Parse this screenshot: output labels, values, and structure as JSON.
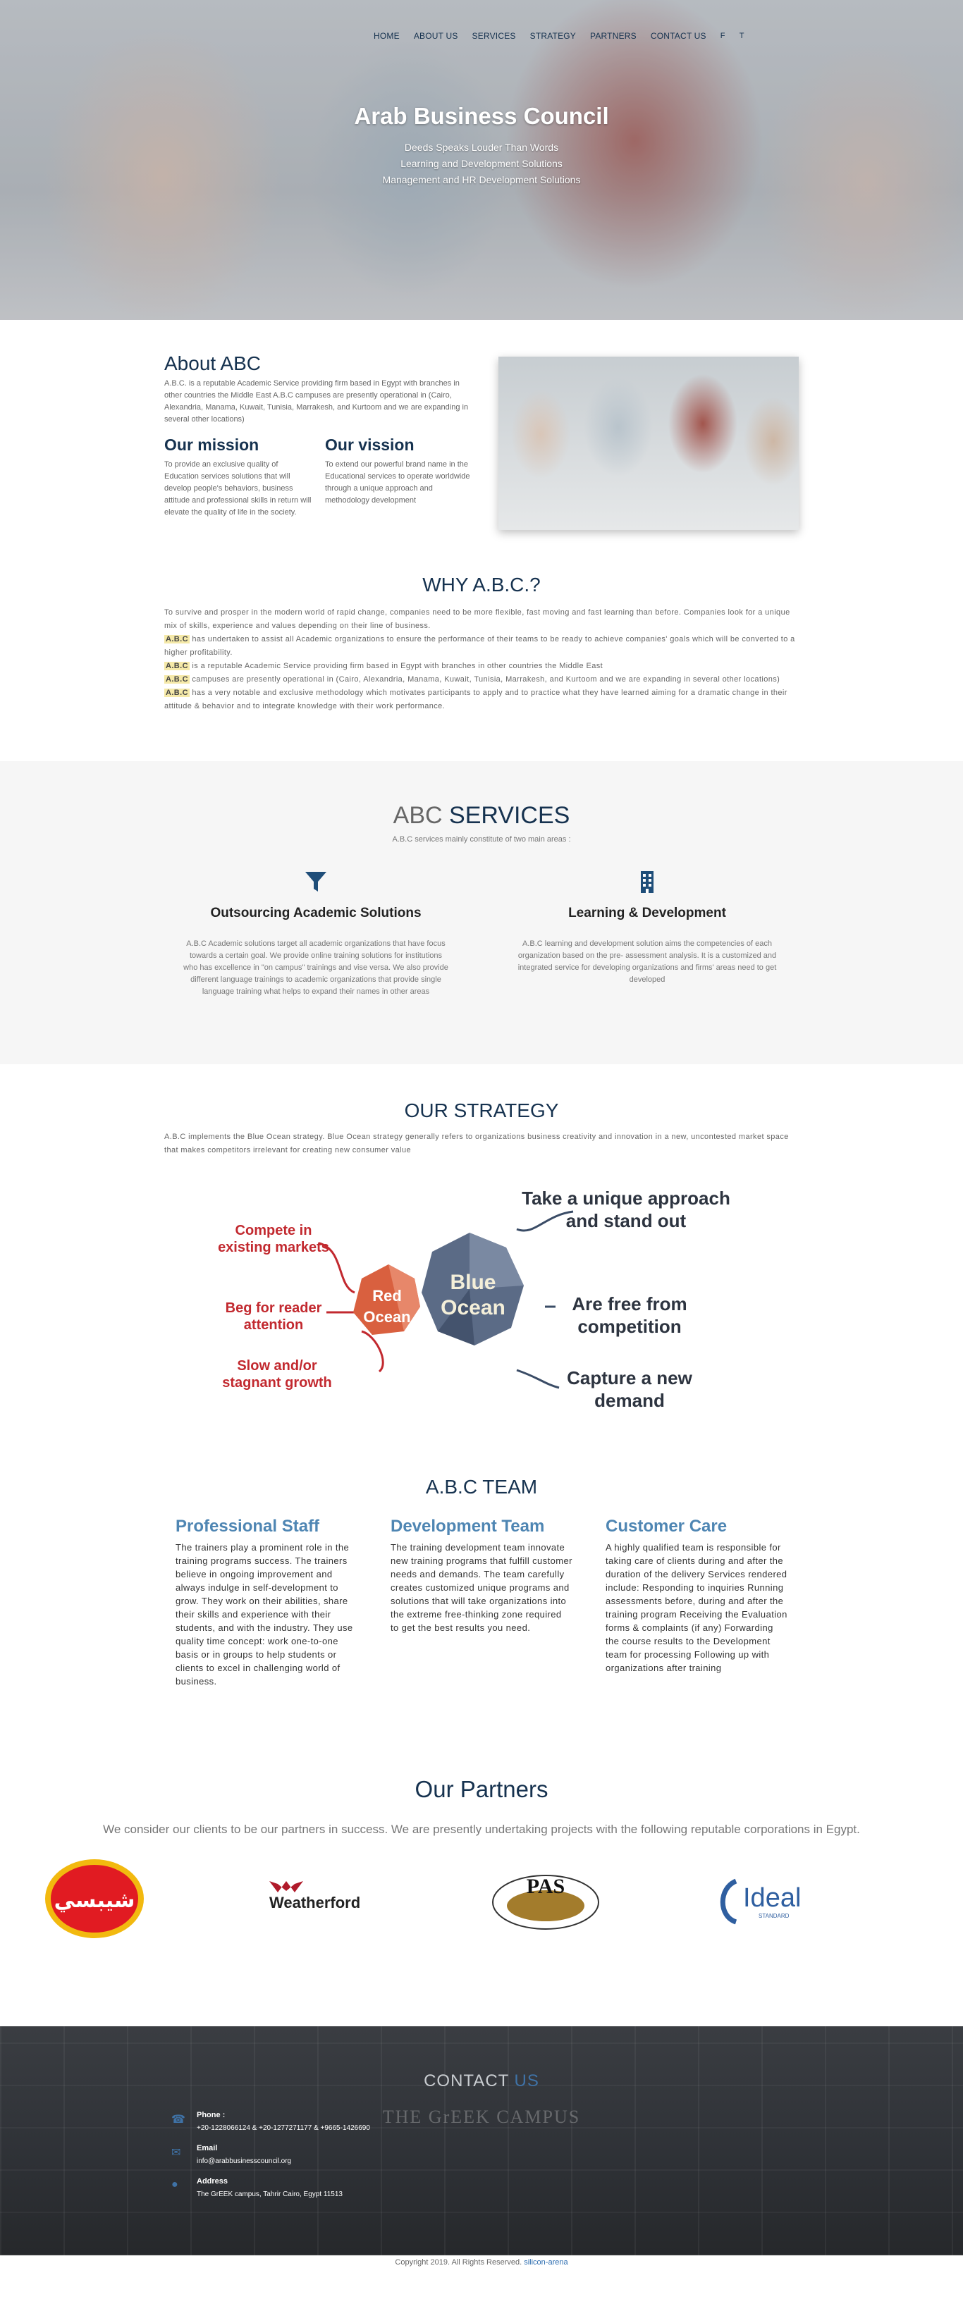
{
  "nav": {
    "items": [
      "HOME",
      "ABOUT US",
      "SERVICES",
      "STRATEGY",
      "PARTNERS",
      "CONTACT US"
    ],
    "social": [
      "f",
      "t"
    ]
  },
  "hero": {
    "title": "Arab Business Council",
    "lines": [
      "Deeds Speaks Louder Than Words",
      "Learning and Development Solutions",
      "Management and HR Development Solutions"
    ]
  },
  "about": {
    "title": "About ABC",
    "text": "A.B.C. is a reputable Academic Service providing firm based in Egypt with branches in other countries the Middle East A.B.C campuses are presently operational in (Cairo, Alexandria, Manama, Kuwait, Tunisia, Marrakesh, and Kurtoom and we are expanding in several other locations)",
    "mission_title": "Our mission",
    "mission_text": "To provide an exclusive quality of Education services solutions that will develop people's behaviors, business attitude and professional skills in return will elevate the quality of life in the society.",
    "vision_title": "Our vission",
    "vision_text": "To extend our powerful brand name in the Educational services to operate worldwide through a unique approach and methodology development"
  },
  "why": {
    "title": "WHY A.B.C.?",
    "intro": "To survive and prosper in the modern world of rapid change, companies need to be more flexible, fast moving and fast learning than before. Companies look for a unique mix of skills, experience and values depending on their line of business.",
    "tag": "A.B.C",
    "p1": " has undertaken to assist all Academic organizations to ensure the performance of their teams to be ready to achieve companies' goals which will be converted to a higher profitability.",
    "p2": " is a reputable Academic Service providing firm based in Egypt with branches in other countries the Middle East",
    "p3": " campuses are presently operational in (Cairo, Alexandria, Manama, Kuwait, Tunisia, Marrakesh, and Kurtoom and we are expanding in several other locations)",
    "p4": " has a very notable and exclusive methodology which motivates participants to apply and to practice what they have learned aiming for a dramatic change in their attitude & behavior and to integrate knowledge with their work performance."
  },
  "services": {
    "title_a": "ABC",
    "title_b": "SERVICES",
    "sub": "A.B.C services mainly constitute of two main areas :",
    "items": [
      {
        "icon": "filter-icon",
        "title": "Outsourcing Academic Solutions",
        "text": "A.B.C Academic solutions target all academic organizations that have focus towards a certain goal. We provide online training solutions for institutions who has excellence in \"on campus\" trainings and vise versa. We also provide different language trainings to academic organizations that provide single language training what helps to expand their names in other areas"
      },
      {
        "icon": "building-icon",
        "title": "Learning & Development",
        "text": "A.B.C learning and development solution aims the competencies of each organization based on the pre- assessment analysis. It is a customized and integrated service for developing organizations and firms' areas need to get developed"
      }
    ]
  },
  "strategy": {
    "title": "OUR STRATEGY",
    "text": "A.B.C implements the Blue Ocean strategy. Blue Ocean strategy generally refers to organizations business creativity and innovation in a new, uncontested market space that makes competitors irrelevant for creating new consumer value",
    "red_title": "Red Ocean",
    "blue_title": "Blue Ocean",
    "red": [
      "Compete in existing markets",
      "Beg for reader attention",
      "Slow and/or stagnant growth"
    ],
    "blue": [
      "Take a unique approach and stand out",
      "Are free from competition",
      "Capture a new demand"
    ]
  },
  "team": {
    "title": "A.B.C TEAM",
    "cols": [
      {
        "title": "Professional Staff",
        "text": "The trainers play a prominent role in the training programs success. The trainers believe in ongoing improvement and always indulge in self-development to grow. They work on their abilities, share their skills and experience with their students, and with the industry. They use quality time concept: work one-to-one basis or in groups to help students or clients to excel in challenging world of business."
      },
      {
        "title": "Development Team",
        "text": "The training development team innovate new training programs that fulfill customer needs and demands. The team carefully creates customized unique programs and solutions that will take organizations into the extreme free-thinking zone required to get the best results you need."
      },
      {
        "title": "Customer Care",
        "text": "A highly qualified team is responsible for taking care of clients during and after the duration of the delivery Services rendered include: Responding to inquiries Running assessments before, during and after the training program Receiving the Evaluation forms & complaints (if any) Forwarding the course results to the Development team for processing Following up with organizations after training"
      }
    ]
  },
  "partners": {
    "title": "Our Partners",
    "sub": "We consider our clients to be our partners in success. We are presently undertaking projects with the following reputable corporations in Egypt.",
    "logos": [
      "شيبسي",
      "Weatherford",
      "PAS",
      "Ideal",
      "STANDARD"
    ]
  },
  "contact": {
    "title_a": "CONTACT",
    "title_b": "US",
    "ghost": "THE GrEEK CAMPUS",
    "phone_label": "Phone :",
    "phone": "+20-1228066124 & +20-1277271177 & +9665-1426690",
    "email_label": "Email",
    "email": "info@arabbusinesscouncil.org",
    "address_label": "Address",
    "address": "The GrEEK campus, Tahrir Cairo, Egypt 11513"
  },
  "footer": {
    "text": "Copyright 2019. All Rights Reserved.",
    "link": "silicon-arena"
  },
  "colors": {
    "brand": "#16324f",
    "accent": "#3f72a6",
    "red_ocean": "#d9603f",
    "blue_ocean": "#5b6b86"
  }
}
